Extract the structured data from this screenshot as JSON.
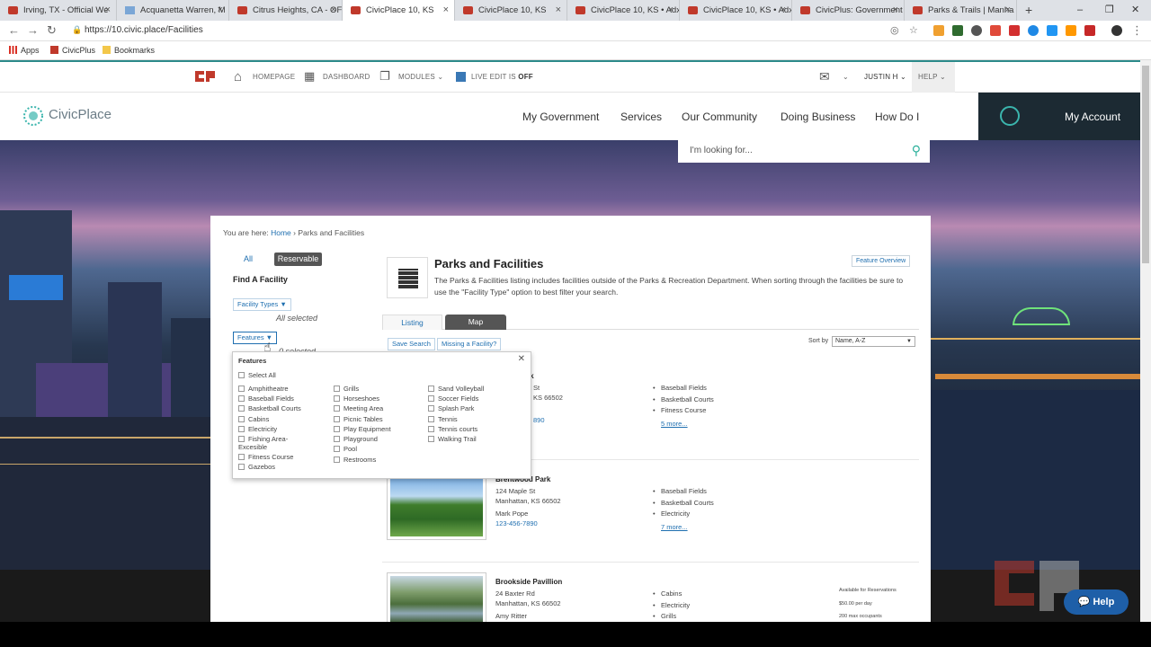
{
  "browser": {
    "tabs": [
      {
        "title": "Irving, TX - Official We"
      },
      {
        "title": "Acquanetta Warren, M"
      },
      {
        "title": "Citrus Heights, CA - OF"
      },
      {
        "title": "CivicPlace 10, KS"
      },
      {
        "title": "CivicPlace 10, KS"
      },
      {
        "title": "CivicPlace 10, KS • Adx"
      },
      {
        "title": "CivicPlace 10, KS • Adx"
      },
      {
        "title": "CivicPlus: Government"
      },
      {
        "title": "Parks & Trails | Manha"
      }
    ],
    "url": "https://10.civic.place/Facilities",
    "bookmarks": [
      "Apps",
      "CivicPlus",
      "Bookmarks"
    ]
  },
  "adminbar": {
    "homepage": "HOMEPAGE",
    "dashboard": "DASHBOARD",
    "modules": "MODULES",
    "live_edit": "LIVE EDIT IS",
    "live_edit_state": "OFF",
    "user": "JUSTIN H",
    "help": "HELP"
  },
  "site": {
    "logo_text": "CivicPlace",
    "nav": [
      "My Government",
      "Services",
      "Our Community",
      "Doing Business",
      "How Do I"
    ],
    "account": "My Account",
    "search_placeholder": "I'm looking for..."
  },
  "breadcrumb": {
    "prefix": "You are here:",
    "home": "Home",
    "sep": "›",
    "current": "Parks and Facilities"
  },
  "sidebar": {
    "tab_all": "All",
    "tab_reservable": "Reservable",
    "find": "Find A Facility",
    "facility_types": "Facility Types ▼",
    "all_selected": "All selected",
    "features": "Features ▼",
    "features_partial": "0 selected"
  },
  "features_dropdown": {
    "header": "Features",
    "select_all": "Select All",
    "col1": [
      "Amphitheatre",
      "Baseball Fields",
      "Basketball Courts",
      "Cabins",
      "Electricity",
      "Fishing Area- Excesible",
      "Fitness Course",
      "Gazebos"
    ],
    "col2": [
      "Grills",
      "Horseshoes",
      "Meeting Area",
      "Picnic Tables",
      "Play Equipment",
      "Playground",
      "Pool",
      "Restrooms"
    ],
    "col3": [
      "Sand Volleyball",
      "Soccer Fields",
      "Splash Park",
      "Tennis",
      "Tennis courts",
      "Walking Trail"
    ]
  },
  "main": {
    "title": "Parks and Facilities",
    "description": "The Parks & Facilities listing includes facilities outside of the Parks & Recreation Department. When sorting through the facilities be sure to use the \"Facility Type\" option to best filter your search.",
    "feature_overview": "Feature Overview",
    "tab_listing": "Listing",
    "tab_map": "Map",
    "save_search": "Save Search",
    "missing": "Missing a Facility?",
    "sort_label": "Sort by",
    "sort_value": "Name, A-Z"
  },
  "facilities": [
    {
      "name": "rk",
      "street": "St",
      "city": "KS 66502",
      "phone": "890",
      "features": [
        "Baseball Fields",
        "Basketball Courts",
        "Fitness Course"
      ],
      "more": "5 more..."
    },
    {
      "name": "Brentwood Park",
      "street": "124 Maple St",
      "city": "Manhattan, KS 66502",
      "contact": "Mark Pope",
      "phone": "123-456-7890",
      "features": [
        "Baseball Fields",
        "Basketball Courts",
        "Electricity"
      ],
      "more": "7 more..."
    },
    {
      "name": "Brookside Pavillion",
      "street": "24 Baxter Rd",
      "city": "Manhattan, KS 66502",
      "contact": "Amy Ritter",
      "features": [
        "Cabins",
        "Electricity",
        "Grills"
      ],
      "notes": [
        "Available for Reservations",
        "$50.00 per day",
        "200 max occupants"
      ]
    }
  ],
  "help_button": "Help",
  "colors": {
    "accent": "#2b8a8a",
    "link": "#1f6fb0",
    "account_bg": "#1c2a33",
    "help": "#1e5fa8"
  }
}
